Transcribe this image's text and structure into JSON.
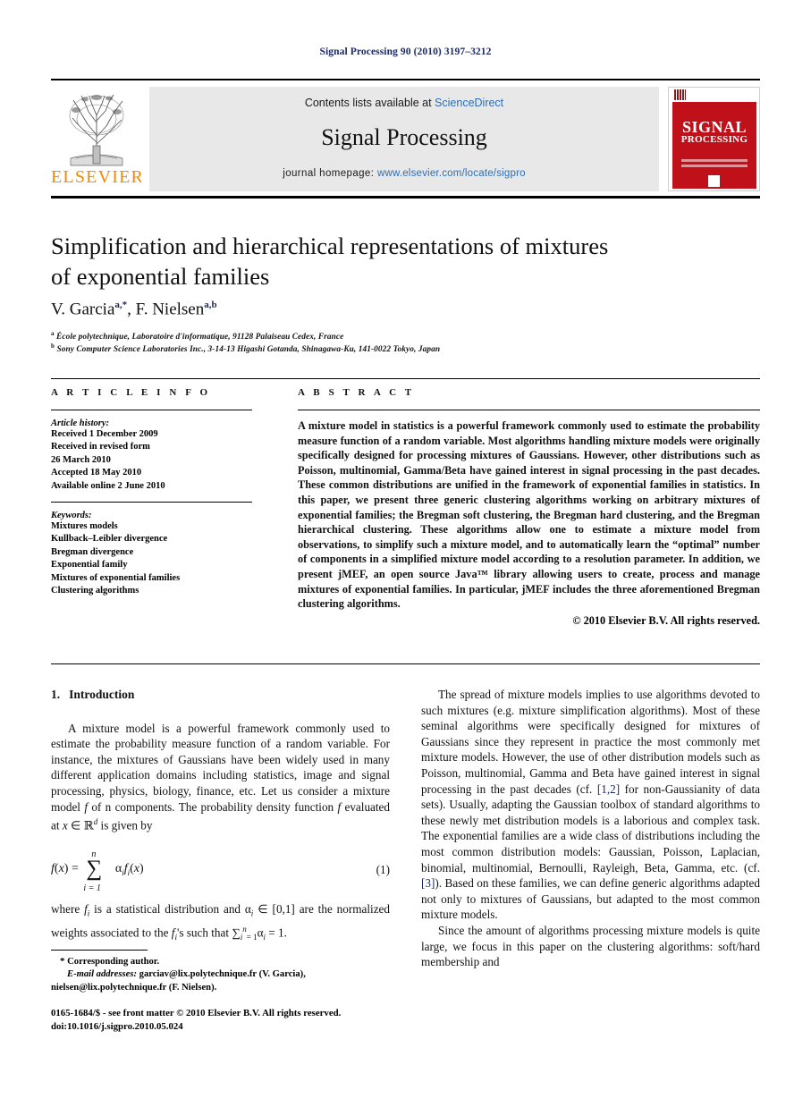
{
  "running_head": "Signal Processing 90 (2010) 3197–3212",
  "masthead": {
    "contents_prefix": "Contents lists available at ",
    "sciencedirect": "ScienceDirect",
    "journal_name": "Signal Processing",
    "homepage_prefix": "journal homepage: ",
    "homepage_url": "www.elsevier.com/locate/sigpro",
    "publisher": "ELSEVIER",
    "cover": {
      "line1": "SIGNAL",
      "line2": "PROCESSING"
    },
    "link_color": "#2a6ebb",
    "band_color": "#e8e8e8",
    "cover_color": "#c0111b",
    "publisher_color": "#f08a00"
  },
  "article": {
    "title_line1": "Simplification and hierarchical representations of mixtures",
    "title_line2": "of exponential families",
    "authors": [
      {
        "name": "V. Garcia",
        "marks": "a,*"
      },
      {
        "name": "F. Nielsen",
        "marks": "a,b"
      }
    ],
    "affiliations": [
      {
        "mark": "a",
        "text": "École polytechnique, Laboratoire d'informatique, 91128 Palaiseau Cedex, France"
      },
      {
        "mark": "b",
        "text": "Sony Computer Science Laboratories Inc., 3-14-13 Higashi Gotanda, Shinagawa-Ku, 141-0022 Tokyo, Japan"
      }
    ]
  },
  "info": {
    "heading": "A R T I C L E   I N F O",
    "history_title": "Article history:",
    "history": [
      "Received 1 December 2009",
      "Received in revised form",
      "26 March 2010",
      "Accepted 18 May 2010",
      "Available online 2 June 2010"
    ],
    "keywords_title": "Keywords:",
    "keywords": [
      "Mixtures models",
      "Kullback–Leibler divergence",
      "Bregman divergence",
      "Exponential family",
      "Mixtures of exponential families",
      "Clustering algorithms"
    ]
  },
  "abstract": {
    "heading": "A B S T R A C T",
    "text": "A mixture model in statistics is a powerful framework commonly used to estimate the probability measure function of a random variable. Most algorithms handling mixture models were originally specifically designed for processing mixtures of Gaussians. However, other distributions such as Poisson, multinomial, Gamma/Beta have gained interest in signal processing in the past decades. These common distributions are unified in the framework of exponential families in statistics. In this paper, we present three generic clustering algorithms working on arbitrary mixtures of exponential families; the Bregman soft clustering, the Bregman hard clustering, and the Bregman hierarchical clustering. These algorithms allow one to estimate a mixture model from observations, to simplify such a mixture model, and to automatically learn the “optimal” number of components in a simplified mixture model according to a resolution parameter. In addition, we present jMEF, an open source Java™ library allowing users to create, process and manage mixtures of exponential families. In particular, jMEF includes the three aforementioned Bregman clustering algorithms.",
    "copyright": "© 2010 Elsevier B.V. All rights reserved."
  },
  "body": {
    "section_number": "1.",
    "section_title": "Introduction",
    "left_para_1": "A mixture model is a powerful framework commonly used to estimate the probability measure function of a random variable. For instance, the mixtures of Gaussians have been widely used in many different application domains including statistics, image and signal processing, physics, biology, finance, etc. Let us consider a mixture model f of n components. The probability density function f evaluated at x ∈ ℝ",
    "left_para_1_tail": " is given by",
    "equation_number": "(1)",
    "equation": {
      "lhs": "f(x) =",
      "sum_upper": "n",
      "sum_lower": "i = 1",
      "term": "αᵢfᵢ(x)"
    },
    "left_para_2": "where f",
    "left_para_2_full": "where fi is a statistical distribution and αi ∈ [0,1] are the normalized weights associated to the fi's such that ∑ⁿi=1 αi = 1.",
    "right_para_1": "The spread of mixture models implies to use algorithms devoted to such mixtures (e.g. mixture simplification algorithms). Most of these seminal algorithms were specifically designed for mixtures of Gaussians since they represent in practice the most commonly met mixture models. However, the use of other distribution models such as Poisson, multinomial, Gamma and Beta have gained interest in signal processing in the past decades (cf. ",
    "right_ref_1": "[1,2]",
    "right_para_1b": " for non-Gaussianity of data sets). Usually, adapting the Gaussian toolbox of standard algorithms to these newly met distribution models is a laborious and complex task. The exponential families are a wide class of distributions including the most common distribution models: Gaussian, Poisson, Laplacian, binomial, multinomial, Bernoulli, Rayleigh, Beta, Gamma, etc. (cf. ",
    "right_ref_2": "[3]",
    "right_para_1c": "). Based on these families, we can define generic algorithms adapted not only to mixtures of Gaussians, but adapted to the most common mixture models.",
    "right_para_2": "Since the amount of algorithms processing mixture models is quite large, we focus in this paper on the clustering algorithms: soft/hard membership and",
    "reference_color": "#1b2a63"
  },
  "footnotes": {
    "corresponding": "Corresponding author.",
    "email_label": "E-mail addresses:",
    "email_1": "garciav@lix.polytechnique.fr (V. Garcia),",
    "email_2": "nielsen@lix.polytechnique.fr (F. Nielsen)."
  },
  "colophon": {
    "line1": "0165-1684/$ - see front matter © 2010 Elsevier B.V. All rights reserved.",
    "line2": "doi:10.1016/j.sigpro.2010.05.024"
  }
}
